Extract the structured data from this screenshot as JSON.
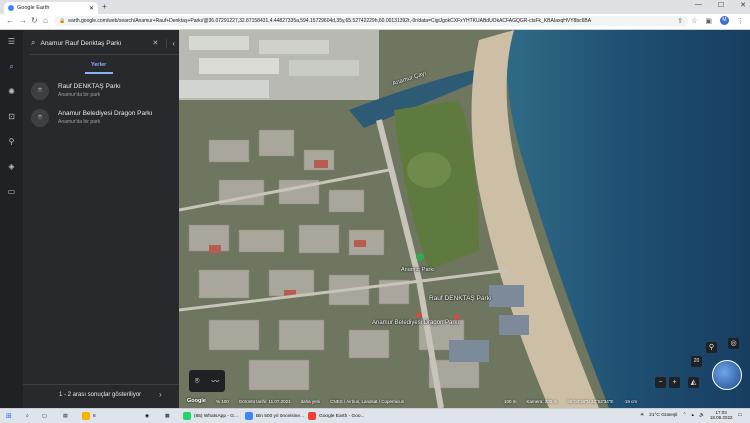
{
  "browser": {
    "tab_title": "Google Earth",
    "url": "earth.google.com/web/search/Anamur+Rauf+Denktaş+Parkı/@36.07291227,32.87158431,4.44827335a,594.15729604d,35y,65.52742229h,60.00131392t,-0r/data=CigiJgokCXFxYHTKUABdUOkACFAGQGR-ctsFk_KBAIaxqHVY8bc6BA"
  },
  "rail": {
    "items": [
      "menu-icon",
      "search-icon",
      "voyager-icon",
      "projects-icon",
      "pegman-icon",
      "layers-icon",
      "measure-icon"
    ]
  },
  "search": {
    "query": "Anamur Rauf Denktaş Parkı",
    "tab_label": "Yerler"
  },
  "results": [
    {
      "title": "Rauf DENKTAŞ Parkı",
      "subtitle": "Anamur'da bir park"
    },
    {
      "title": "Anamur Belediyesi Dragon Parkı",
      "subtitle": "Anamur'da bir park"
    }
  ],
  "footer": {
    "text": "1 - 2 arası sonuçlar gösteriliyor"
  },
  "map": {
    "labels": {
      "river": "Anamur Çayı",
      "park1": "Rauf DENKTAŞ Parkı",
      "park2": "Anamur Belediyesi Dragon Parkı",
      "place": "Anamur Parkı"
    },
    "compass_label": "20",
    "status": {
      "google": "Google",
      "scale": "% 100",
      "imagery": "Görüntü tarihi: 11.07.2021",
      "freshness": "daha yeni",
      "credits": "CNES / Airbus, Landsat / Copernicus",
      "distance": "100 m",
      "camera": "Kamera: 302 m",
      "coords": "36°04'18\"N 32°52'34\"E",
      "elevation": "-19 cm"
    }
  },
  "taskbar": {
    "items": [
      {
        "label": "(65) WhatsApp - G...",
        "color": "#25d366"
      },
      {
        "label": "Bin 500 yıl önceisine...",
        "color": "#4285f4"
      },
      {
        "label": "Google Earth - Goo...",
        "color": "#ea4335"
      }
    ],
    "weather": "21°C Güneşli",
    "time": "17:03",
    "date": "18.09.2022",
    "notif": "6"
  }
}
